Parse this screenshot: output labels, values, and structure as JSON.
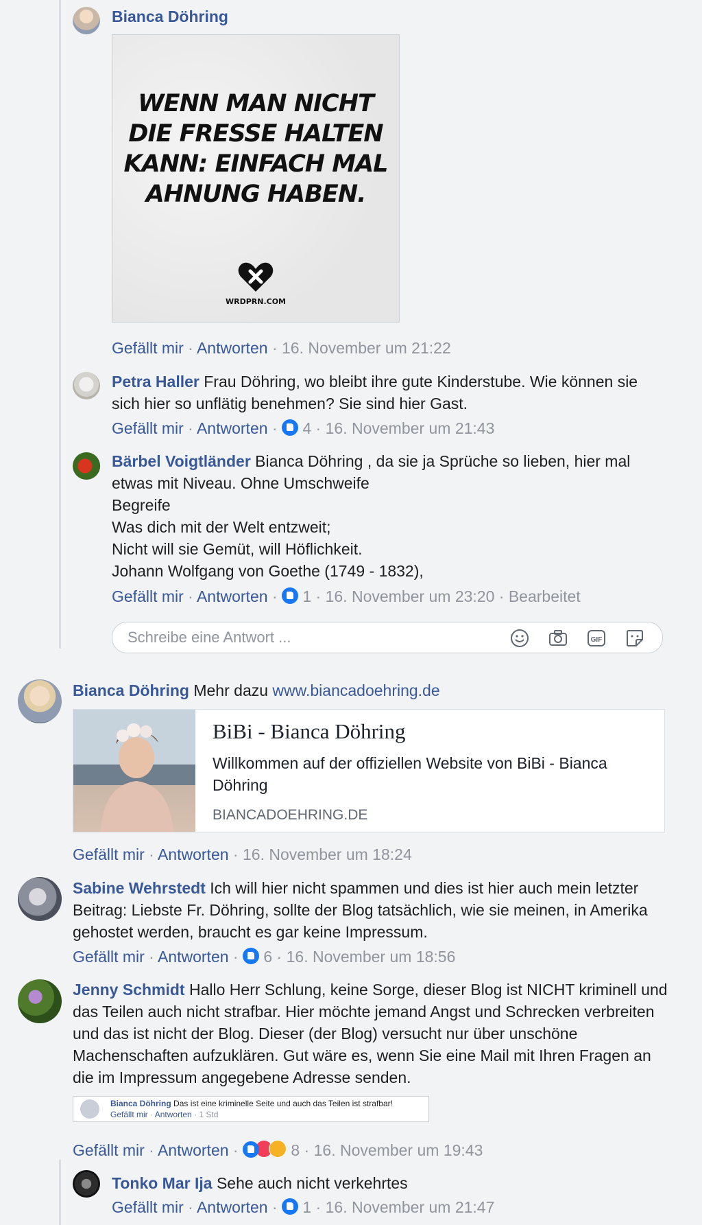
{
  "comments": [
    {
      "author": "Bianca Döhring",
      "image_text": [
        "WENN MAN NICHT",
        "DIE FRESSE HALTEN",
        "KANN: EINFACH MAL",
        "AHNUNG HABEN."
      ],
      "image_brand": "WRDPRN.COM",
      "like": "Gefällt mir",
      "reply": "Antworten",
      "time": "16. November um 21:22"
    },
    {
      "author": "Petra Haller",
      "text": "Frau Döhring, wo bleibt ihre gute Kinderstube. Wie können sie sich hier so unflätig benehmen? Sie sind hier Gast.",
      "like": "Gefällt mir",
      "reply": "Antworten",
      "reactions": "4",
      "time": "16. November um 21:43"
    },
    {
      "author": "Bärbel Voigtländer",
      "text": "Bianca Döhring , da sie ja Sprüche so lieben, hier mal etwas mit Niveau. Ohne Umschweife",
      "lines": [
        "Begreife",
        "Was dich mit der Welt entzweit;",
        "Nicht will sie Gemüt, will Höflichkeit.",
        "Johann Wolfgang von Goethe (1749 - 1832),"
      ],
      "like": "Gefällt mir",
      "reply": "Antworten",
      "reactions": "1",
      "time": "16. November um 23:20",
      "edited": "Bearbeitet"
    },
    {
      "author": "Bianca Döhring",
      "text": "Mehr dazu",
      "link": "www.biancadoehring.de",
      "card": {
        "title": "BiBi - Bianca Döhring",
        "description": "Willkommen auf der offiziellen Website von BiBi - Bianca Döhring",
        "domain": "BIANCADOEHRING.DE"
      },
      "like": "Gefällt mir",
      "reply": "Antworten",
      "time": "16. November um 18:24"
    },
    {
      "author": "Sabine Wehrstedt",
      "text": "Ich will hier nicht spammen und dies ist hier auch mein letzter Beitrag: Liebste Fr. Döhring, sollte der Blog tatsächlich, wie sie meinen, in Amerika gehostet werden, braucht es gar keine Impressum.",
      "like": "Gefällt mir",
      "reply": "Antworten",
      "reactions": "6",
      "time": "16. November um 18:56"
    },
    {
      "author": "Jenny Schmidt",
      "text": "Hallo Herr Schlung, keine Sorge, dieser Blog ist NICHT kriminell und das Teilen auch nicht strafbar. Hier möchte jemand Angst und Schrecken verbreiten und das ist nicht der Blog. Dieser (der Blog) versucht nur über unschöne Machenschaften aufzuklären. Gut wäre es, wenn Sie eine Mail mit Ihren Fragen an die im Impressum angegebene Adresse senden.",
      "quote": {
        "author": "Bianca Döhring",
        "text": "Das ist eine kriminelle Seite und auch das Teilen ist strafbar!",
        "like": "Gefällt mir",
        "reply": "Antworten",
        "time": "1 Std"
      },
      "like": "Gefällt mir",
      "reply": "Antworten",
      "reactions": "8",
      "time": "16. November um 19:43"
    },
    {
      "author": "Tonko Mar Ija",
      "text": "Sehe auch nicht verkehrtes",
      "like": "Gefällt mir",
      "reply": "Antworten",
      "reactions": "1",
      "time": "16. November um 21:47"
    }
  ],
  "reply_box": {
    "placeholder": "Schreibe eine Antwort ..."
  },
  "icons": [
    "emoji-icon",
    "camera-icon",
    "gif-icon",
    "sticker-icon"
  ]
}
